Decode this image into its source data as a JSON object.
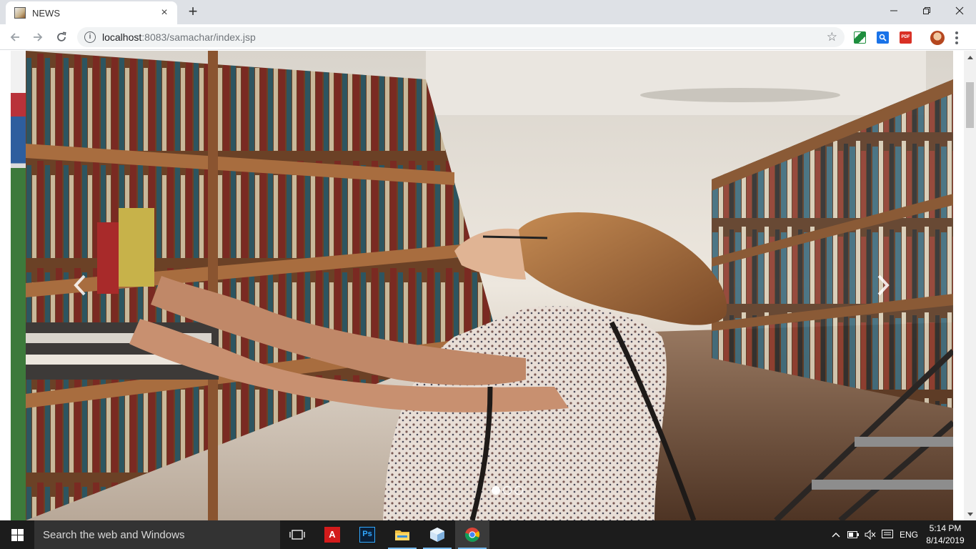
{
  "browser": {
    "tab": {
      "title": "NEWS",
      "close_glyph": "×"
    },
    "new_tab_glyph": "+",
    "window_controls": {
      "minimize": "minimize-icon",
      "maximize": "restore-icon",
      "close": "close-icon"
    },
    "address": {
      "host": "localhost",
      "path": ":8083/samachar/index.jsp"
    },
    "extensions": [
      "sheet-extension-icon",
      "search-extension-icon",
      "pdf-extension-icon"
    ]
  },
  "page": {
    "carousel": {
      "prev_glyph": "‹",
      "next_glyph": "›",
      "slide_count": 3,
      "active_slide": 1
    }
  },
  "taskbar": {
    "search_placeholder": "Search the web and Windows",
    "apps": [
      "task-view-icon",
      "acrobat-icon",
      "photoshop-icon",
      "file-explorer-icon",
      "3d-box-app-icon",
      "chrome-icon"
    ],
    "tray": {
      "language": "ENG"
    },
    "clock": {
      "time": "5:14 PM",
      "date": "8/14/2019"
    }
  },
  "colors": {
    "tabstrip": "#dee1e6",
    "taskbar": "#1c1c1c",
    "taskbar_accent": "#76b9ed"
  }
}
